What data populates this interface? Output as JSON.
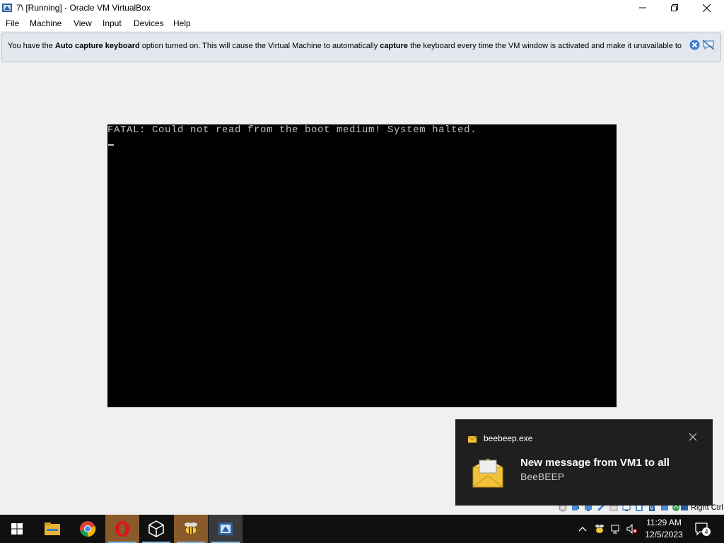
{
  "window": {
    "title": "7\\ [Running] - Oracle VM VirtualBox",
    "controls": [
      "minimize-icon",
      "restore-icon",
      "close-icon"
    ]
  },
  "menu": {
    "items": [
      "File",
      "Machine",
      "View",
      "Input",
      "Devices",
      "Help"
    ]
  },
  "banner": {
    "part1": "You have the ",
    "bold1": "Auto capture keyboard",
    "part2": " option turned on. This will cause the Virtual Machine to automatically ",
    "bold2": "capture",
    "part3": " the keyboard every time the VM window is activated and make it unavailable to"
  },
  "vm": {
    "message": "FATAL: Could not read from the boot medium! System halted.",
    "background": "#000000",
    "text_color": "#c0c0c0"
  },
  "statusbar": {
    "host_key": "Right Ctrl",
    "icons": [
      "optical-drive-icon",
      "audio-icon",
      "network-icon",
      "usb-icon",
      "shared-folder-icon",
      "display-icon",
      "recording-icon",
      "cpu-icon",
      "mouse-integration-icon",
      "keyboard-icon"
    ]
  },
  "toast": {
    "app": "beebeep.exe",
    "title": "New message from VM1 to all",
    "subtitle": "BeeBEEP"
  },
  "taskbar": {
    "apps": [
      "start-icon",
      "file-explorer-icon",
      "chrome-icon",
      "opera-icon",
      "virtualbox-icon",
      "beebeep-icon",
      "vm-window-icon"
    ],
    "clock_time": "11:29 AM",
    "clock_date": "12/5/2023",
    "notification_count": "4",
    "accent": "#76b9ed"
  }
}
